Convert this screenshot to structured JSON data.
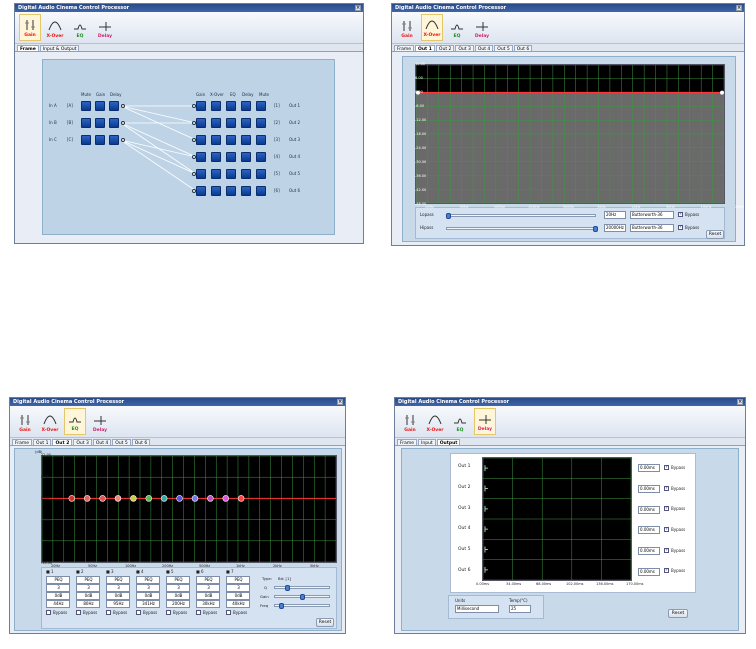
{
  "app_title": "Digital Audio Cinema Control Processor",
  "toolbar": {
    "gain": "Gain",
    "xover": "X-Over",
    "eq": "EQ",
    "delay": "Delay"
  },
  "colors": {
    "titlebar": "#2a4a86",
    "plot_bg": "#000000",
    "grid": "#3f9a3f",
    "level_line": "#ff3333"
  },
  "win1": {
    "tabs": [
      "Frame",
      "Input & Output"
    ],
    "col_headers_in": [
      "Mute",
      "Gain",
      "Delay"
    ],
    "col_headers_out": [
      "Gain",
      "X-Over",
      "EQ",
      "Delay",
      "Mute"
    ],
    "inputs": [
      "In A",
      "In B",
      "In C"
    ],
    "input_ids": [
      "[A]",
      "[B]",
      "[C]"
    ],
    "outputs": [
      "Out 1",
      "Out 2",
      "Out 3",
      "Out 4",
      "Out 5",
      "Out 6"
    ],
    "output_ids": [
      "[1]",
      "[2]",
      "[3]",
      "[4]",
      "[5]",
      "[6]"
    ]
  },
  "win2": {
    "tabs": [
      "Frame",
      "Out 1",
      "Out 2",
      "Out 3",
      "Out 4",
      "Out 5",
      "Out 6"
    ],
    "y_ticks": [
      "12.00",
      "6.00",
      "0.00",
      "-6.00",
      "-12.00",
      "-18.00",
      "-24.00",
      "-30.00",
      "-36.00",
      "-42.00",
      "-48.00"
    ],
    "x_ticks": [
      "20Hz",
      "50Hz",
      "100Hz",
      "200Hz",
      "500Hz",
      "1kHz",
      "2kHz",
      "5kHz",
      "10kHz",
      "20kHz"
    ],
    "lowpass_label": "Lopass",
    "hipass_label": "Hipass",
    "lowpass_freq": "20Hz",
    "hipass_freq": "20000Hz",
    "filter_type": "Butterworth-36",
    "bypass_label": "Bypass",
    "reset": "Reset"
  },
  "win3": {
    "tabs": [
      "Frame",
      "Out 1",
      "Out 2",
      "Out 3",
      "Out 4",
      "Out 5",
      "Out 6"
    ],
    "y_label": "(dB)",
    "y_ticks": [
      "12.00",
      "6.00",
      "0.00",
      "-6.00",
      "-12.00",
      "-18.00"
    ],
    "x_ticks": [
      "20Hz",
      "50Hz",
      "100Hz",
      "200Hz",
      "500Hz",
      "1kHz",
      "2kHz",
      "5kHz",
      "20kHz"
    ],
    "bands": [
      {
        "n": "1",
        "type": "PEQ",
        "q": "3",
        "gain": "0dB",
        "freq": "44Hz"
      },
      {
        "n": "2",
        "type": "PEQ",
        "q": "3",
        "gain": "0dB",
        "freq": "80Hz"
      },
      {
        "n": "3",
        "type": "PEQ",
        "q": "3",
        "gain": "0dB",
        "freq": "95Hz"
      },
      {
        "n": "4",
        "type": "PEQ",
        "q": "3",
        "gain": "0dB",
        "freq": "341Hz"
      },
      {
        "n": "5",
        "type": "PEQ",
        "q": "3",
        "gain": "0dB",
        "freq": "200Hz"
      },
      {
        "n": "6",
        "type": "PEQ",
        "q": "3",
        "gain": "0dB",
        "freq": "30kHz"
      },
      {
        "n": "7",
        "type": "PEQ",
        "q": "3",
        "gain": "0dB",
        "freq": "40kHz"
      }
    ],
    "bypass_label": "Bypass",
    "type_label": "Type:",
    "band_label": "Bd: [1]",
    "q_label": "Q",
    "gain_label": "Gain",
    "freq_label": "Freq",
    "reset": "Reset"
  },
  "win4": {
    "tabs": [
      "Frame",
      "Input",
      "Output"
    ],
    "outputs": [
      "Out 1",
      "Out 2",
      "Out 3",
      "Out 4",
      "Out 5",
      "Out 6"
    ],
    "delays": [
      "0.00ms",
      "0.00ms",
      "0.00ms",
      "0.00ms",
      "0.00ms",
      "0.00ms"
    ],
    "x_ticks": [
      "0.00ms",
      "34.00ms",
      "68.00ms",
      "102.00ms",
      "136.00ms",
      "170.00ms"
    ],
    "bypass_label": "Bypass",
    "units_label": "Units",
    "units_value": "Millisecond",
    "temp_label": "Temp(°C)",
    "temp_value": "25",
    "reset": "Reset"
  }
}
